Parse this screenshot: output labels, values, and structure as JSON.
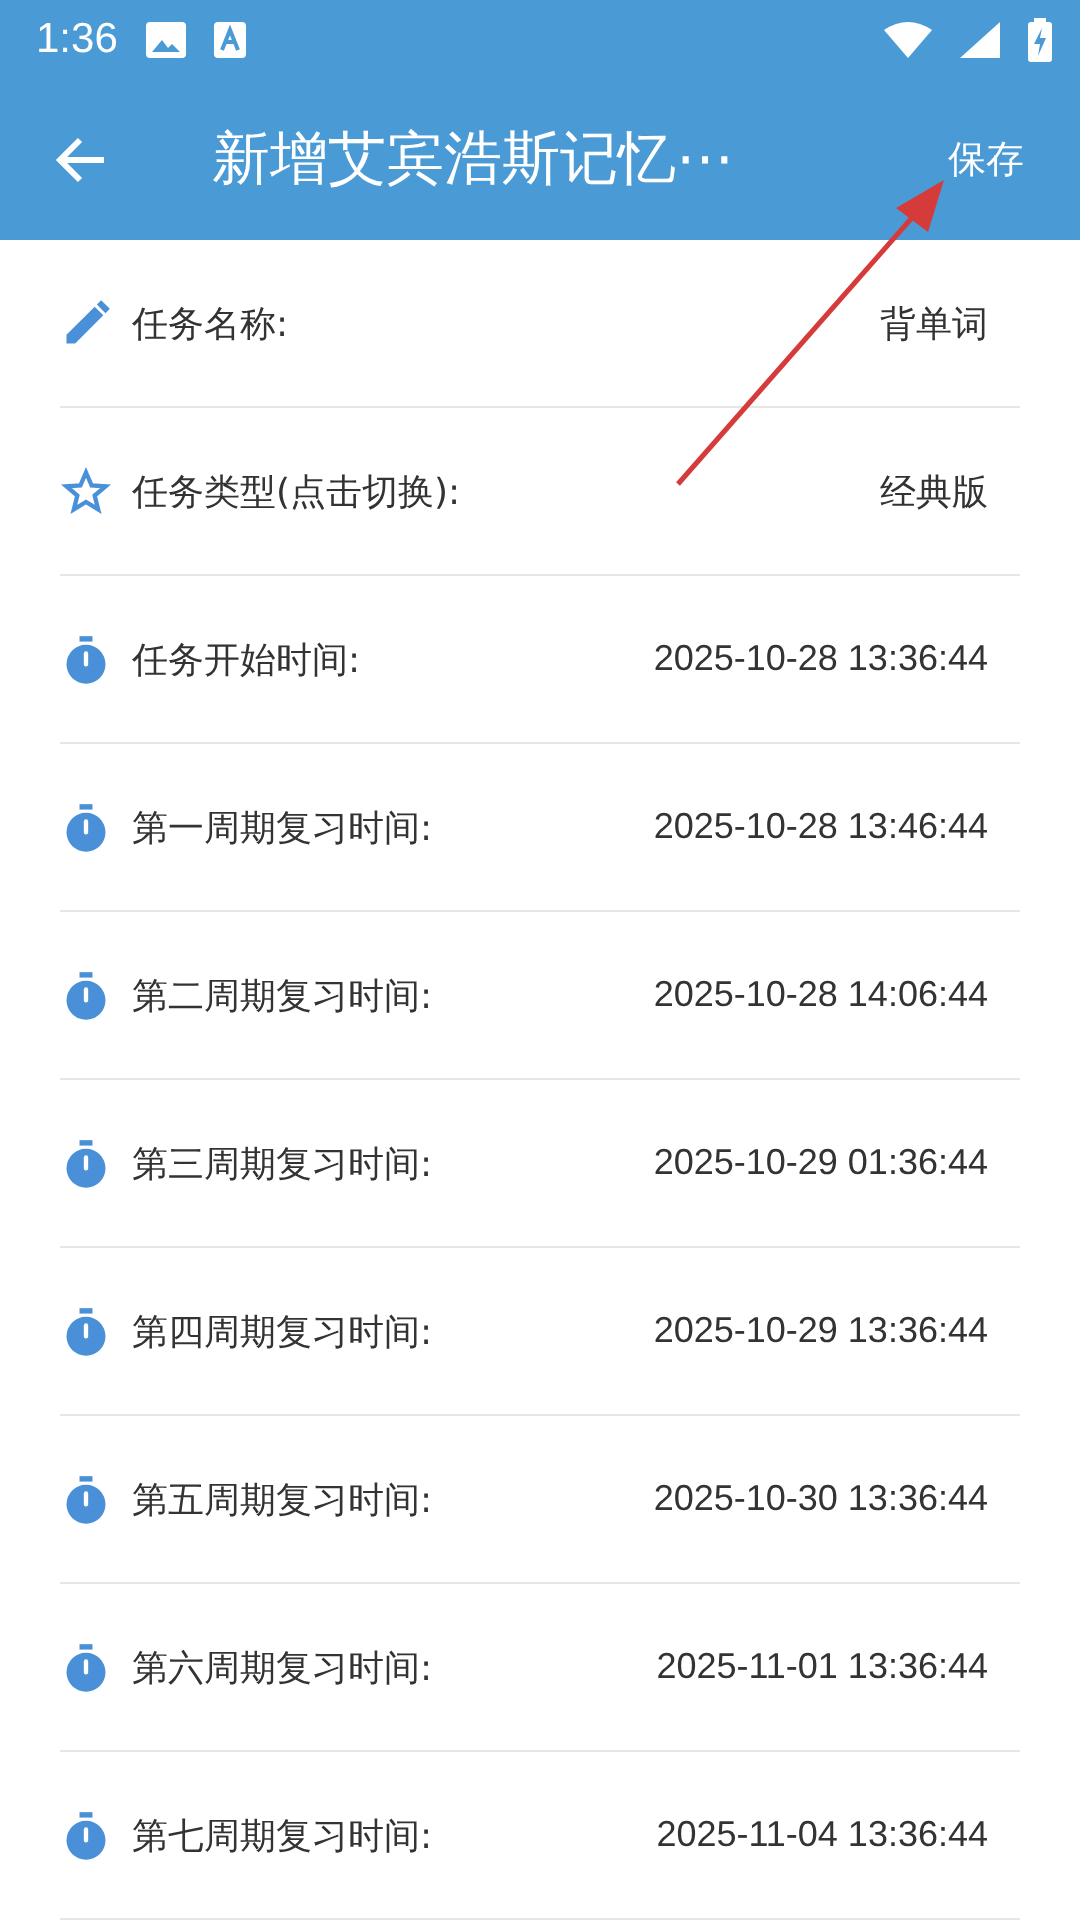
{
  "status_bar": {
    "time": "1:36"
  },
  "app_bar": {
    "title": "新增艾宾浩斯记忆⋯",
    "action": "保存"
  },
  "rows": [
    {
      "kind": "name",
      "label": "任务名称:",
      "value": "背单词"
    },
    {
      "kind": "type",
      "label": "任务类型(点击切换):",
      "value": "经典版"
    },
    {
      "kind": "time",
      "label": "任务开始时间:",
      "value": "2025-10-28 13:36:44"
    },
    {
      "kind": "time",
      "label": "第一周期复习时间:",
      "value": "2025-10-28 13:46:44"
    },
    {
      "kind": "time",
      "label": "第二周期复习时间:",
      "value": "2025-10-28 14:06:44"
    },
    {
      "kind": "time",
      "label": "第三周期复习时间:",
      "value": "2025-10-29 01:36:44"
    },
    {
      "kind": "time",
      "label": "第四周期复习时间:",
      "value": "2025-10-29 13:36:44"
    },
    {
      "kind": "time",
      "label": "第五周期复习时间:",
      "value": "2025-10-30 13:36:44"
    },
    {
      "kind": "time",
      "label": "第六周期复习时间:",
      "value": "2025-11-01 13:36:44"
    },
    {
      "kind": "time",
      "label": "第七周期复习时间:",
      "value": "2025-11-04 13:36:44"
    }
  ]
}
